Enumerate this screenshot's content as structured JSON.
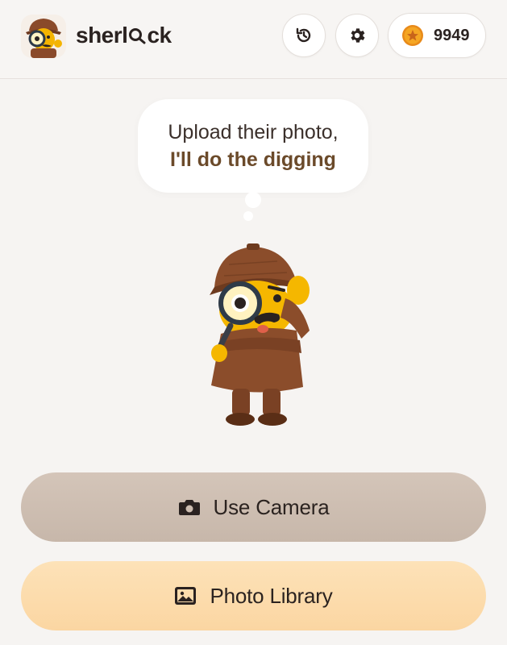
{
  "header": {
    "brand_name": "sherlock",
    "brand_prefix": "sherl",
    "brand_suffix": "ck",
    "coin_count": "9949",
    "icons": {
      "logo": "detective-mascot-icon",
      "history": "history-icon",
      "settings": "gear-icon",
      "coin": "star-coin-icon"
    }
  },
  "bubble": {
    "line1": "Upload their photo,",
    "line2": "I'll do the digging"
  },
  "actions": {
    "camera_label": "Use Camera",
    "library_label": "Photo Library",
    "camera_icon": "camera-icon",
    "library_icon": "image-icon"
  },
  "colors": {
    "background": "#f6f4f2",
    "camera_button": "#cdbdb0",
    "library_button": "#fcdcad",
    "accent_text": "#6b4a2a",
    "coin": "#f0a020"
  }
}
